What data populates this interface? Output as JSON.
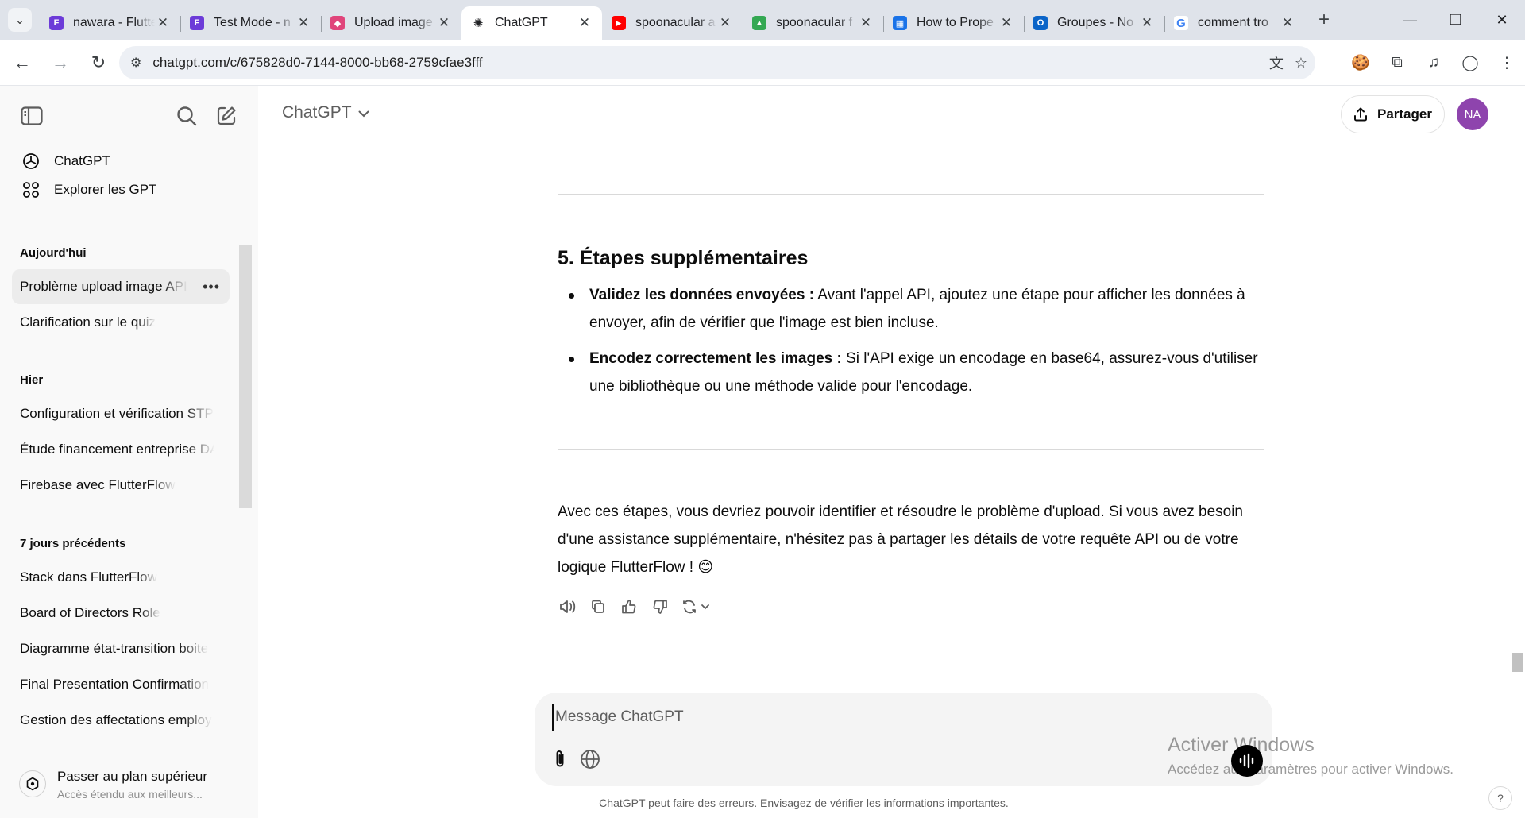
{
  "browser": {
    "tabs": [
      {
        "title": "nawara - Flutte",
        "favicon_color": "#6c3bd8"
      },
      {
        "title": "Test Mode - n",
        "favicon_color": "#6c3bd8"
      },
      {
        "title": "Upload image",
        "favicon_color": "#e0457b"
      },
      {
        "title": "ChatGPT",
        "favicon_color": "#202124",
        "active": true
      },
      {
        "title": "spoonacular a",
        "favicon_color": "#ff0000"
      },
      {
        "title": "spoonacular f",
        "favicon_color": "#34a853"
      },
      {
        "title": "How to Prope",
        "favicon_color": "#1a73e8"
      },
      {
        "title": "Groupes - No",
        "favicon_color": "#0a64c8"
      },
      {
        "title": "comment tro",
        "favicon_color": "#4285f4"
      }
    ],
    "url": "chatgpt.com/c/675828d0-7144-8000-bb68-2759cfae3fff"
  },
  "sidebar": {
    "nav": [
      {
        "label": "ChatGPT"
      },
      {
        "label": "Explorer les GPT"
      }
    ],
    "sections": [
      {
        "heading": "Aujourd'hui",
        "items": [
          "Problème upload image API",
          "Clarification sur le quiz"
        ]
      },
      {
        "heading": "Hier",
        "items": [
          "Configuration et vérification STP",
          "Étude financement entreprise DA",
          "Firebase avec FlutterFlow"
        ]
      },
      {
        "heading": "7 jours précédents",
        "items": [
          "Stack dans FlutterFlow",
          "Board of Directors Role",
          "Diagramme état-transition boite",
          "Final Presentation Confirmation",
          "Gestion des affectations employ"
        ]
      }
    ],
    "upgrade": {
      "title": "Passer au plan supérieur",
      "subtitle": "Accès étendu aux meilleurs..."
    }
  },
  "header": {
    "title": "ChatGPT",
    "share_label": "Partager",
    "avatar_initials": "NA",
    "avatar_color": "#8e44ad"
  },
  "message": {
    "section_title": "5. Étapes supplémentaires",
    "bullets": [
      {
        "bold": "Validez les données envoyées :",
        "text": " Avant l'appel API, ajoutez une étape pour afficher les données à envoyer, afin de vérifier que l'image est bien incluse."
      },
      {
        "bold": "Encodez correctement les images :",
        "text": " Si l'API exige un encodage en base64, assurez-vous d'utiliser une bibliothèque ou une méthode valide pour l'encodage."
      }
    ],
    "closing": "Avec ces étapes, vous devriez pouvoir identifier et résoudre le problème d'upload. Si vous avez besoin d'une assistance supplémentaire, n'hésitez pas à partager les détails de votre requête API ou de votre logique FlutterFlow ! 😊"
  },
  "composer": {
    "placeholder": "Message ChatGPT"
  },
  "disclaimer": "ChatGPT peut faire des erreurs. Envisagez de vérifier les informations importantes.",
  "help_label": "?",
  "watermark": {
    "line1": "Activer Windows",
    "line2": "Accédez aux paramètres pour activer Windows."
  }
}
